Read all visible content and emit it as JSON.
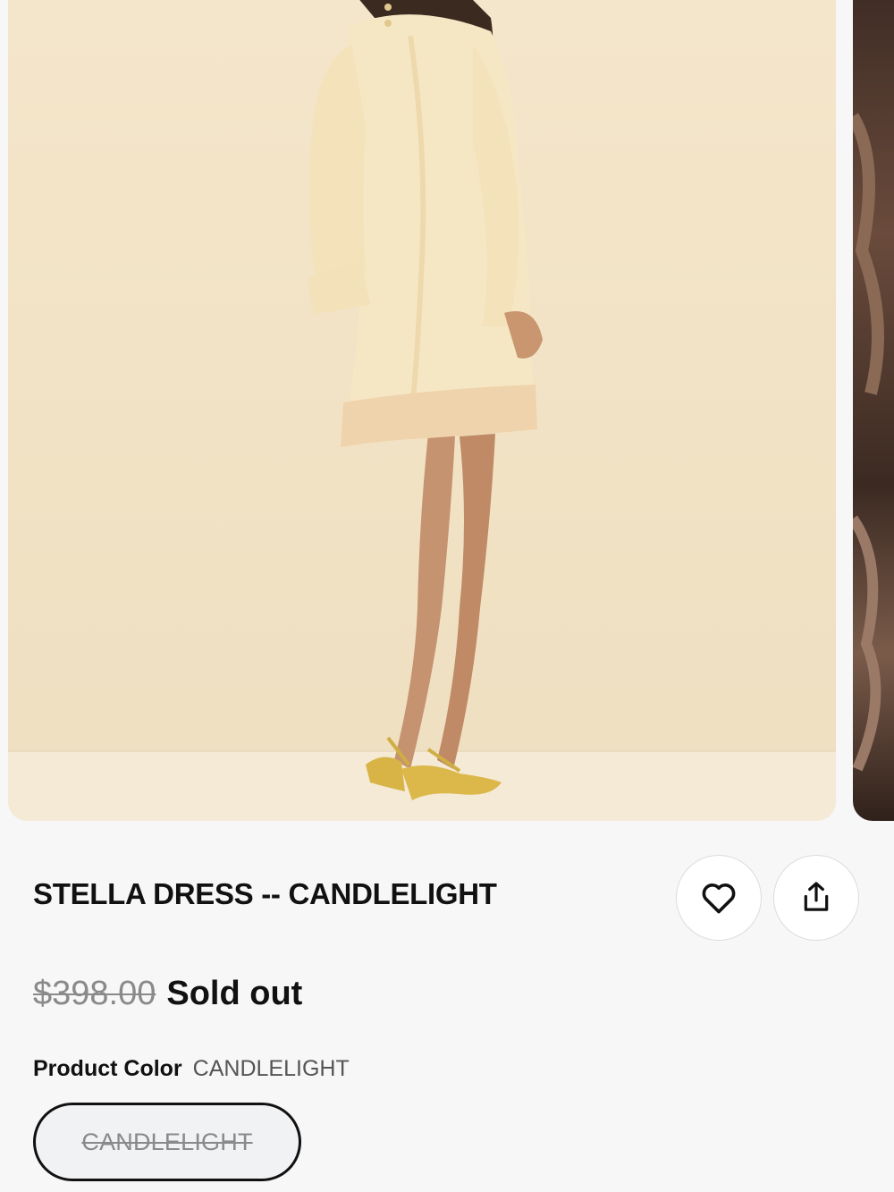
{
  "product": {
    "title": "STELLA DRESS -- CANDLELIGHT",
    "original_price": "$398.00",
    "status": "Sold out",
    "color_label": "Product Color",
    "color_value": "CANDLELIGHT",
    "swatches": [
      {
        "label": "CANDLELIGHT",
        "selected": true,
        "available": false
      }
    ]
  },
  "actions": {
    "favorite_icon": "heart-icon",
    "share_icon": "share-icon"
  },
  "gallery": {
    "images": [
      {
        "depicts": "model-back-view"
      },
      {
        "depicts": "next-image-peek"
      }
    ]
  },
  "colors": {
    "backdrop": "#f3e5c9",
    "dress": "#f6e8c6",
    "sandals": "#d9b64a",
    "skin": "#c99670",
    "text": "#111111",
    "muted": "#8a8a8a"
  }
}
